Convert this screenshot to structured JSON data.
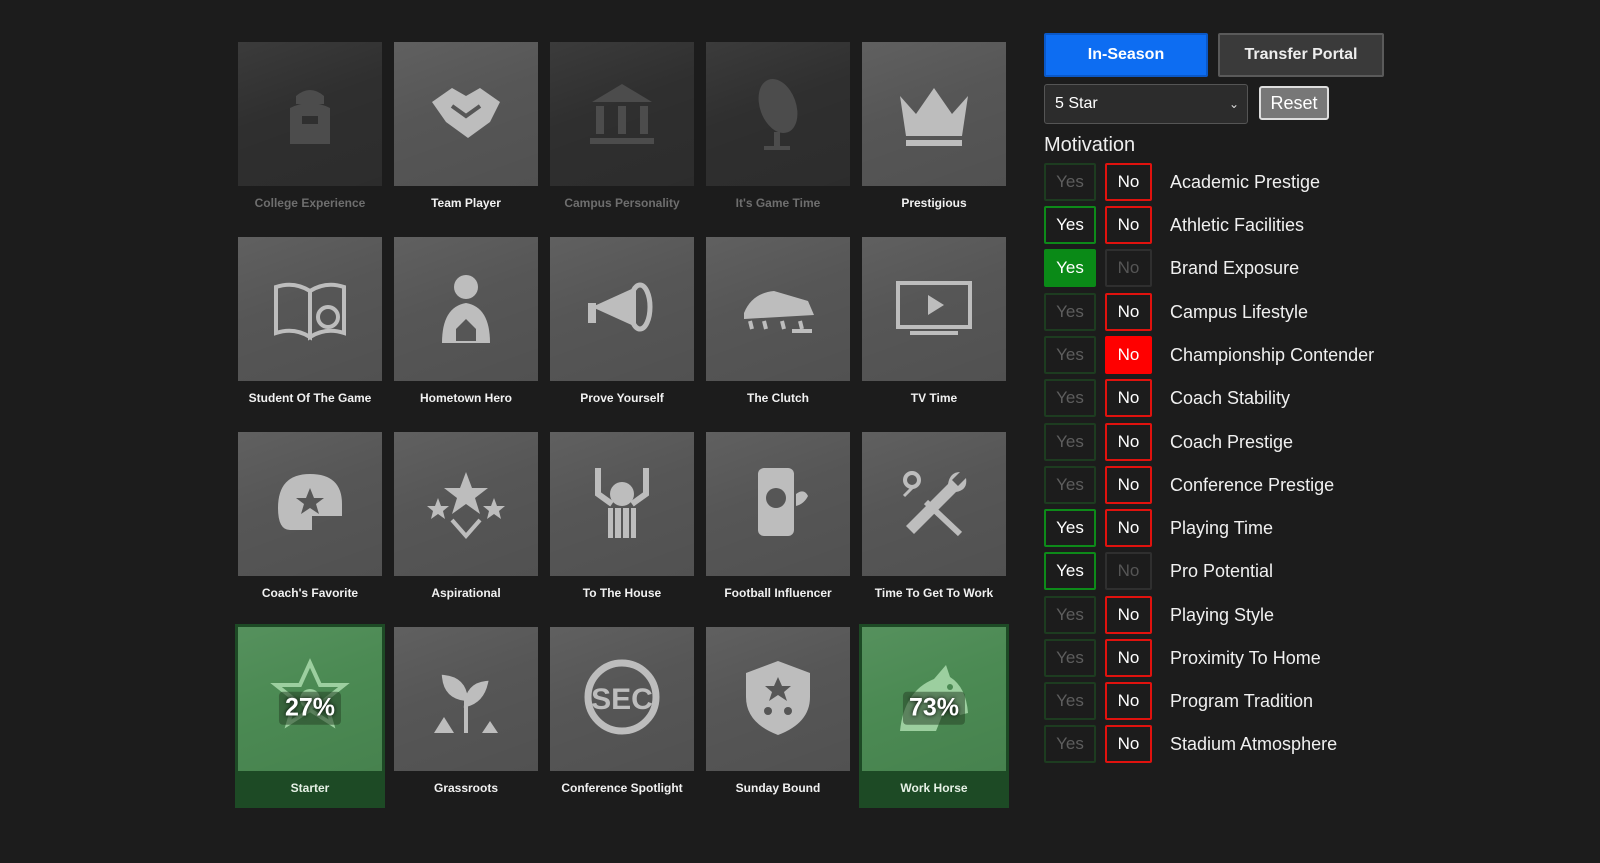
{
  "tiles": [
    {
      "label": "College Experience",
      "icon": "backpack-icon",
      "state": "dim"
    },
    {
      "label": "Team Player",
      "icon": "handshake-icon",
      "state": "normal"
    },
    {
      "label": "Campus Personality",
      "icon": "building-icon",
      "state": "dim"
    },
    {
      "label": "It's Game Time",
      "icon": "football-icon",
      "state": "dim"
    },
    {
      "label": "Prestigious",
      "icon": "crown-icon",
      "state": "normal"
    },
    {
      "label": "Student Of The Game",
      "icon": "book-icon",
      "state": "normal"
    },
    {
      "label": "Hometown Hero",
      "icon": "player-house-icon",
      "state": "normal"
    },
    {
      "label": "Prove Yourself",
      "icon": "megaphone-icon",
      "state": "normal"
    },
    {
      "label": "The Clutch",
      "icon": "cleat-icon",
      "state": "normal"
    },
    {
      "label": "TV Time",
      "icon": "tv-icon",
      "state": "normal"
    },
    {
      "label": "Coach's Favorite",
      "icon": "helmet-star-icon",
      "state": "normal"
    },
    {
      "label": "Aspirational",
      "icon": "stars-icon",
      "state": "normal"
    },
    {
      "label": "To The House",
      "icon": "touchdown-icon",
      "state": "normal"
    },
    {
      "label": "Football Influencer",
      "icon": "phone-icon",
      "state": "normal"
    },
    {
      "label": "Time To Get To Work",
      "icon": "tools-icon",
      "state": "normal"
    },
    {
      "label": "Starter",
      "icon": "star-badge-icon",
      "state": "selected",
      "percent": "27%"
    },
    {
      "label": "Grassroots",
      "icon": "sprout-icon",
      "state": "normal"
    },
    {
      "label": "Conference Spotlight",
      "icon": "sec-logo-icon",
      "state": "normal"
    },
    {
      "label": "Sunday Bound",
      "icon": "shield-stars-icon",
      "state": "normal"
    },
    {
      "label": "Work Horse",
      "icon": "horse-icon",
      "state": "selected",
      "percent": "73%"
    }
  ],
  "tabs": {
    "in_season": "In-Season",
    "transfer_portal": "Transfer Portal",
    "active": "in_season"
  },
  "star_select": {
    "value": "5 Star"
  },
  "reset_label": "Reset",
  "motivation_title": "Motivation",
  "yes_label": "Yes",
  "no_label": "No",
  "motivations": [
    {
      "label": "Academic Prestige",
      "yes": "plain",
      "no": "on"
    },
    {
      "label": "Athletic Facilities",
      "yes": "on",
      "no": "on"
    },
    {
      "label": "Brand Exposure",
      "yes": "active",
      "no": "off"
    },
    {
      "label": "Campus Lifestyle",
      "yes": "plain",
      "no": "on"
    },
    {
      "label": "Championship Contender",
      "yes": "plain",
      "no": "active"
    },
    {
      "label": "Coach Stability",
      "yes": "plain",
      "no": "on"
    },
    {
      "label": "Coach Prestige",
      "yes": "plain",
      "no": "on"
    },
    {
      "label": "Conference Prestige",
      "yes": "plain",
      "no": "on"
    },
    {
      "label": "Playing Time",
      "yes": "on",
      "no": "on"
    },
    {
      "label": "Pro Potential",
      "yes": "on",
      "no": "off"
    },
    {
      "label": "Playing Style",
      "yes": "plain",
      "no": "on"
    },
    {
      "label": "Proximity To Home",
      "yes": "plain",
      "no": "on"
    },
    {
      "label": "Program Tradition",
      "yes": "plain",
      "no": "on"
    },
    {
      "label": "Stadium Atmosphere",
      "yes": "plain",
      "no": "on"
    }
  ],
  "colors": {
    "accent_blue": "#0d6df2",
    "yes_green": "#0a8a17",
    "no_red": "#ff0000",
    "selected_tile": "#4b8a53"
  }
}
